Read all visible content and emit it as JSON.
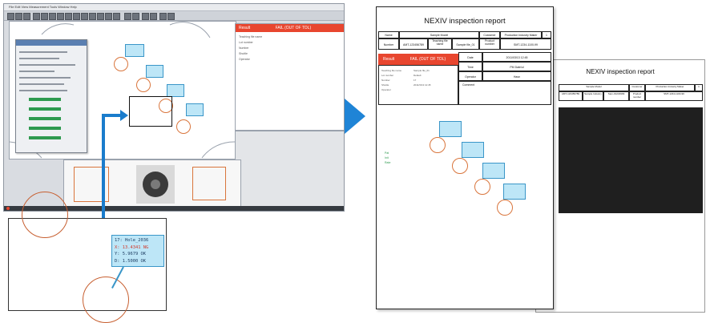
{
  "app": {
    "menu": "File   Edit   View   Measurement   Tools   Window   Help",
    "result_panel": {
      "label": "Result",
      "status": "FAIL (OUT OF TOL)",
      "rows": [
        "Teaching file name",
        "Lot number",
        "Number",
        "Shuttle",
        "Operator"
      ]
    }
  },
  "zoom": {
    "tag": {
      "line1": "17: Hole_2036",
      "line2": "X: 13.4341 NG",
      "line3": "Y:  5.9679 OK",
      "line4": "D:  1.5000 OK"
    }
  },
  "report1": {
    "title": "NEXIV inspection report",
    "name_label": "Name",
    "sample_name": "Sample Model",
    "customer_label": "Customer",
    "customer_value": "Production Industry Maker",
    "customer_no": "1",
    "number_label": "Number",
    "number_value": "AMT-123456789",
    "teaching_label": "Teaching file name",
    "teaching_value": "Sample file_01",
    "product_label": "Product number",
    "product_value": "SMT-1234-1100-99",
    "result_label": "Result",
    "result_status": "FAIL (OUT OF TOL)",
    "date_label": "Date",
    "date_value": "2011/03/13 12:45",
    "time_label": "Time",
    "time_value": "PM  Date/ul",
    "operator_label": "Operator",
    "operator_value": "Hasn",
    "comment_label": "Comment",
    "left_rows": [
      "Teaching file name",
      "Lot number",
      "Number",
      "Shuttle",
      "Operator"
    ],
    "left_values": [
      "Sample file_01",
      "Default",
      "17",
      "2011/3/13 12:45",
      ""
    ],
    "green_marks": [
      "Pat",
      "Init",
      "Rate"
    ]
  },
  "report2": {
    "title": "NEXIV inspection report",
    "sample_name": "Sample Model",
    "customer_label": "Customer",
    "customer_value": "Production Industry Maker",
    "customer_no": "1",
    "number_value": "AMT-123456789",
    "teaching_value": "Sample Industry",
    "file_value": "Sam-01234999",
    "product_label": "Product number",
    "product_value": "SMT-1234-1100-99"
  },
  "colors": {
    "accent_blue": "#1f84d6",
    "fail_red": "#e8462f",
    "tag_blue": "#bde6f7",
    "hole_orange": "#d9753c"
  }
}
